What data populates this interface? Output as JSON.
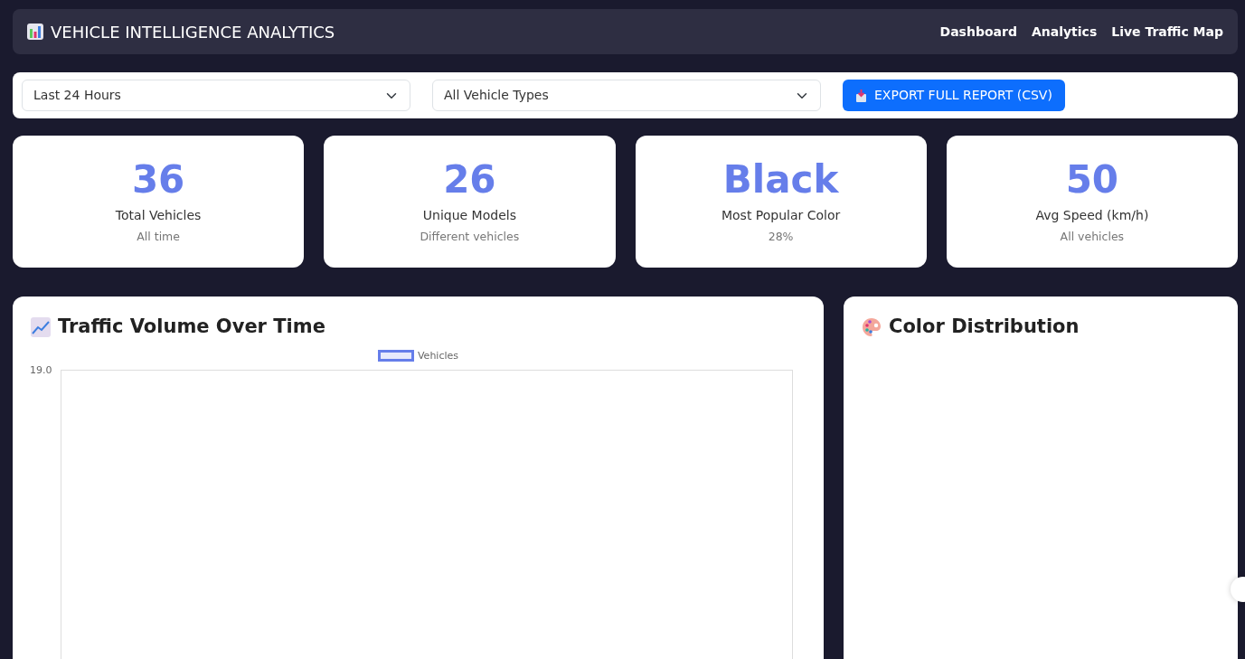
{
  "header": {
    "title": "VEHICLE INTELLIGENCE ANALYTICS",
    "nav": [
      {
        "label": "Dashboard"
      },
      {
        "label": "Analytics"
      },
      {
        "label": "Live Traffic Map"
      }
    ]
  },
  "filters": {
    "selects": [
      {
        "value": "Last 24 Hours"
      },
      {
        "value": "All Vehicle Types"
      }
    ],
    "export_button": "EXPORT FULL REPORT (CSV)"
  },
  "stats": [
    {
      "value": "36",
      "label": "Total Vehicles",
      "note": "All time"
    },
    {
      "value": "26",
      "label": "Unique Models",
      "note": "Different vehicles"
    },
    {
      "value": "Black",
      "label": "Most Popular Color",
      "note": "28%"
    },
    {
      "value": "50",
      "label": "Avg Speed (km/h)",
      "note": "All vehicles"
    }
  ],
  "panels": [
    {
      "kind": "line",
      "title": "Traffic Volume Over Time",
      "legend": "Vehicles",
      "y_tick": "19.0"
    },
    {
      "kind": "color",
      "title": "Color Distribution"
    }
  ]
}
